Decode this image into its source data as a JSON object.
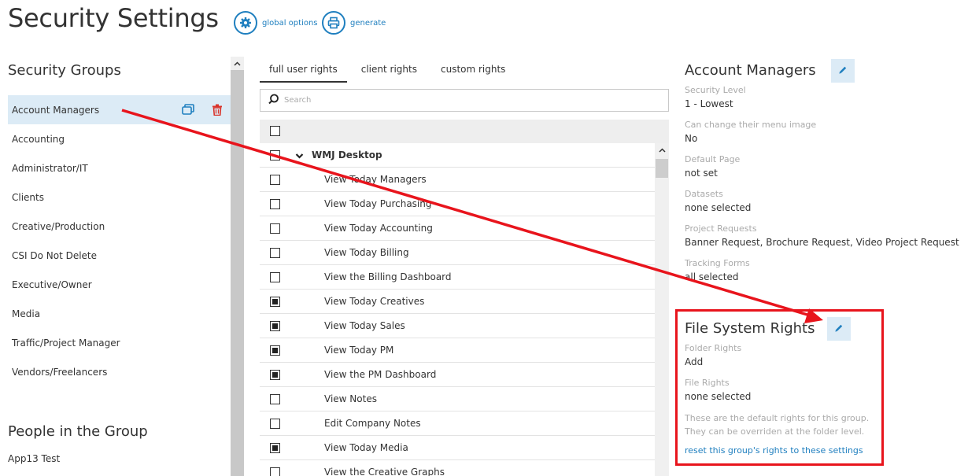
{
  "header": {
    "title": "Security Settings",
    "actions": [
      {
        "label": "global options",
        "icon": "gear-icon"
      },
      {
        "label": "generate",
        "icon": "printer-icon"
      }
    ]
  },
  "security_groups": {
    "heading": "Security Groups",
    "items": [
      {
        "label": "Account Managers",
        "selected": true
      },
      {
        "label": "Accounting"
      },
      {
        "label": "Administrator/IT"
      },
      {
        "label": "Clients"
      },
      {
        "label": "Creative/Production"
      },
      {
        "label": "CSI Do Not Delete"
      },
      {
        "label": "Executive/Owner"
      },
      {
        "label": "Media"
      },
      {
        "label": "Traffic/Project Manager"
      },
      {
        "label": "Vendors/Freelancers"
      }
    ]
  },
  "people": {
    "heading": "People in the Group",
    "items": [
      "App13 Test"
    ]
  },
  "tabs": [
    {
      "label": "full user rights",
      "active": true
    },
    {
      "label": "client rights"
    },
    {
      "label": "custom rights"
    }
  ],
  "search": {
    "placeholder": "Search",
    "value": ""
  },
  "rights": {
    "group_label": "WMJ Desktop",
    "items": [
      {
        "label": "View Today Managers",
        "checked": false
      },
      {
        "label": "View Today Purchasing",
        "checked": false
      },
      {
        "label": "View Today Accounting",
        "checked": false
      },
      {
        "label": "View Today Billing",
        "checked": false
      },
      {
        "label": "View the Billing Dashboard",
        "checked": false
      },
      {
        "label": "View Today Creatives",
        "checked": true
      },
      {
        "label": "View Today Sales",
        "checked": true
      },
      {
        "label": "View Today PM",
        "checked": true
      },
      {
        "label": "View the PM Dashboard",
        "checked": true
      },
      {
        "label": "View Notes",
        "checked": false
      },
      {
        "label": "Edit Company Notes",
        "checked": false
      },
      {
        "label": "View Today Media",
        "checked": true
      },
      {
        "label": "View the Creative Graphs",
        "checked": false
      }
    ]
  },
  "account_panel": {
    "title": "Account Managers",
    "fields": [
      {
        "label": "Security Level",
        "value": "1 - Lowest"
      },
      {
        "label": "Can change their menu image",
        "value": "No"
      },
      {
        "label": "Default Page",
        "value": "not set"
      },
      {
        "label": "Datasets",
        "value": "none selected"
      },
      {
        "label": "Project Requests",
        "value": "Banner Request, Brochure Request, Video Project Request"
      },
      {
        "label": "Tracking Forms",
        "value": "all selected"
      }
    ]
  },
  "file_system_panel": {
    "title": "File System Rights",
    "fields": [
      {
        "label": "Folder Rights",
        "value": "Add"
      },
      {
        "label": "File Rights",
        "value": "none selected"
      }
    ],
    "note_line1": "These are the default rights for this group.",
    "note_line2": "They can be overriden at the folder level.",
    "reset_link": "reset this group's rights to these settings"
  },
  "colors": {
    "accent": "#1f7fbf",
    "selected_bg": "#dcebf6",
    "delete": "#d9342b",
    "annotation": "#e8141c"
  }
}
